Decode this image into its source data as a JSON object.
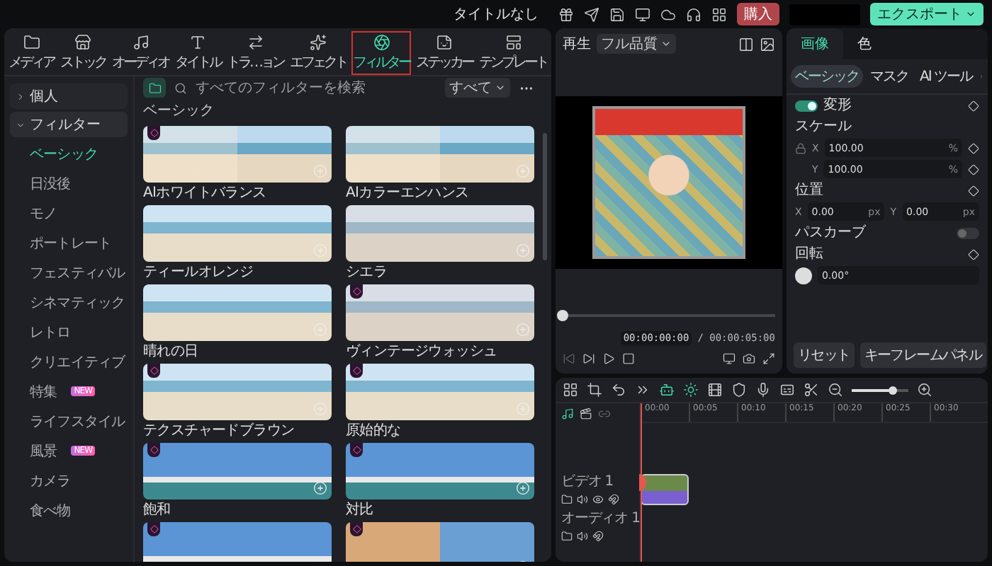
{
  "window": {
    "title": "タイトルなし"
  },
  "header": {
    "buy_button": "購入",
    "export_button": "エクスポート"
  },
  "media_tabs": [
    {
      "label": "メディア",
      "kind": "media",
      "selected": false
    },
    {
      "label": "ストック",
      "kind": "stock",
      "selected": false
    },
    {
      "label": "オーディオ",
      "kind": "audio",
      "selected": false
    },
    {
      "label": "タイトル",
      "kind": "title",
      "selected": false
    },
    {
      "label": "トラ…ョン",
      "kind": "transition",
      "selected": false
    },
    {
      "label": "エフェクト",
      "kind": "effect",
      "selected": false
    },
    {
      "label": "フィルター",
      "kind": "filter",
      "selected": true
    },
    {
      "label": "ステッカー",
      "kind": "sticker",
      "selected": false
    },
    {
      "label": "テンプレート",
      "kind": "template",
      "selected": false
    }
  ],
  "sidebar": {
    "items": [
      {
        "label": "個人",
        "expanded": false
      },
      {
        "label": "フィルター",
        "expanded": true,
        "children": [
          {
            "label": "ベーシック",
            "selected": true
          },
          {
            "label": "日没後",
            "selected": false
          },
          {
            "label": "モノ",
            "selected": false
          },
          {
            "label": "ポートレート",
            "selected": false
          },
          {
            "label": "フェスティバル",
            "selected": false
          },
          {
            "label": "シネマティック",
            "selected": false
          },
          {
            "label": "レトロ",
            "selected": false
          },
          {
            "label": "クリエイティブ",
            "selected": false
          },
          {
            "label": "特集",
            "selected": false,
            "badge": "NEW"
          },
          {
            "label": "ライフスタイル",
            "selected": false
          },
          {
            "label": "風景",
            "selected": false,
            "badge": "NEW"
          },
          {
            "label": "カメラ",
            "selected": false
          },
          {
            "label": "食べ物",
            "selected": false
          }
        ]
      }
    ]
  },
  "search": {
    "placeholder": "すべてのフィルターを検索"
  },
  "category_select": "すべて",
  "section_title": "ベーシック",
  "filters": [
    {
      "name": "AIホワイトバランス",
      "premium": true,
      "kind": "split"
    },
    {
      "name": "AIカラーエンハンス",
      "premium": false,
      "kind": "split"
    },
    {
      "name": "ティールオレンジ",
      "premium": false,
      "kind": "beach"
    },
    {
      "name": "シエラ",
      "premium": false,
      "kind": "faded"
    },
    {
      "name": "晴れの日",
      "premium": false,
      "kind": "beach"
    },
    {
      "name": "ヴィンテージウォッシュ",
      "premium": true,
      "kind": "faded"
    },
    {
      "name": "テクスチャードブラウン",
      "premium": true,
      "kind": "beach"
    },
    {
      "name": "原始的な",
      "premium": true,
      "kind": "beach"
    },
    {
      "name": "飽和",
      "premium": true,
      "kind": "blue"
    },
    {
      "name": "対比",
      "premium": true,
      "kind": "blue"
    },
    {
      "premium": true,
      "kind": "blue"
    },
    {
      "premium": true,
      "kind": "warm"
    }
  ],
  "preview": {
    "play_label": "再生",
    "quality": "フル品質",
    "timecode": "00:00:00:00",
    "duration": "/ 00:00:05:00",
    "level": 0
  },
  "properties": {
    "tabs": [
      {
        "label": "画像",
        "selected": true
      },
      {
        "label": "色",
        "selected": false
      }
    ],
    "subtabs": [
      {
        "label": "ベーシック",
        "selected": true
      },
      {
        "label": "マスク",
        "selected": false
      },
      {
        "label": "AI ツール",
        "selected": false
      }
    ],
    "transform": {
      "label": "変形",
      "on": true
    },
    "scale": {
      "label": "スケール",
      "fields": [
        {
          "axis": "X",
          "value": "100.00",
          "unit": "%"
        },
        {
          "axis": "Y",
          "value": "100.00",
          "unit": "%"
        }
      ]
    },
    "position": {
      "label": "位置",
      "fields": [
        {
          "axis": "X",
          "value": "0.00",
          "unit": "px"
        },
        {
          "axis": "Y",
          "value": "0.00",
          "unit": "px"
        }
      ]
    },
    "path_curve": {
      "label": "パスカーブ",
      "on": false
    },
    "rotation": {
      "label": "回転",
      "value": "0.00°"
    },
    "buttons": [
      "リセット",
      "キーフレームパネル"
    ]
  },
  "timeline": {
    "zoom": {
      "level": 0.72
    },
    "ruler": [
      "00:00",
      "00:05",
      "00:10",
      "00:15",
      "00:20",
      "00:25",
      "00:30"
    ],
    "tracks": [
      {
        "label": "ビデオ 1",
        "kind": "video"
      },
      {
        "label": "オーディオ 1",
        "kind": "audio"
      }
    ]
  }
}
